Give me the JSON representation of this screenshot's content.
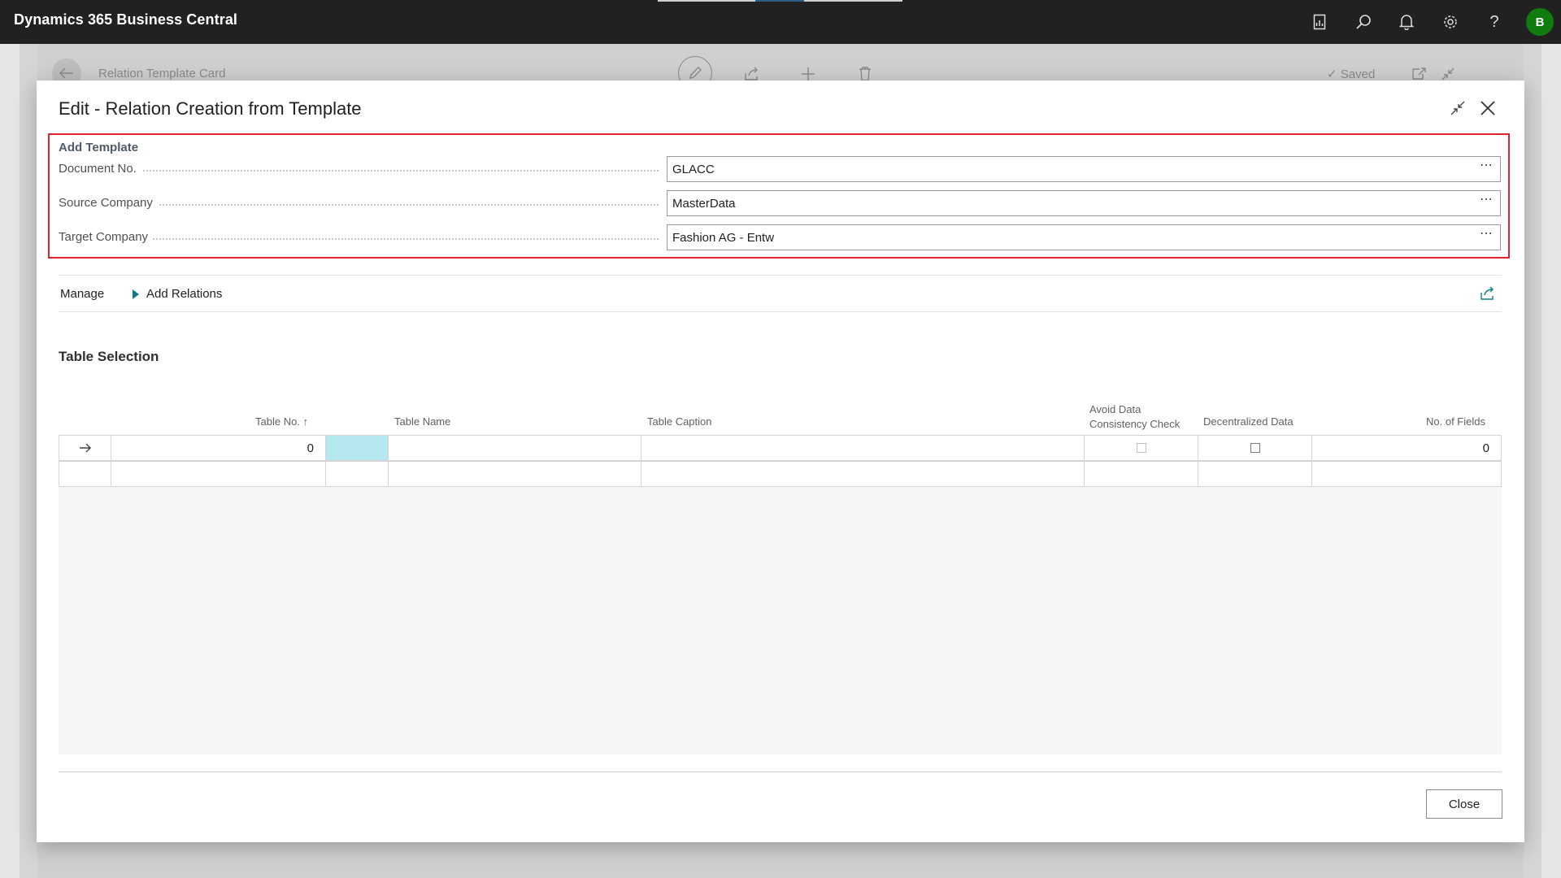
{
  "app": {
    "title": "Dynamics 365 Business Central",
    "avatar_initial": "B"
  },
  "topbar_icons": [
    "report-icon",
    "search-icon",
    "bell-icon",
    "gear-icon",
    "help-icon"
  ],
  "background_page": {
    "title": "Relation Template Card",
    "saved_label": "Saved"
  },
  "dialog": {
    "title": "Edit - Relation Creation from Template",
    "fasttab": {
      "title": "Add Template",
      "fields": [
        {
          "label": "Document No.",
          "value": "GLACC"
        },
        {
          "label": "Source Company",
          "value": "MasterData"
        },
        {
          "label": "Target Company",
          "value": "Fashion AG - Entw"
        }
      ],
      "ellipsis": "⋯"
    },
    "actions": {
      "manage": "Manage",
      "add_relations": "Add Relations"
    },
    "table_section": {
      "title": "Table Selection",
      "columns": {
        "table_no": "Table No. ↑",
        "table_name": "Table Name",
        "table_caption": "Table Caption",
        "avoid_check_1": "Avoid Data",
        "avoid_check_2": "Consistency Check",
        "decentralized": "Decentralized Data",
        "no_of_fields": "No. of Fields"
      },
      "rows": [
        {
          "table_no": "0",
          "table_name": "",
          "table_caption": "",
          "avoid_check": false,
          "decentralized": false,
          "no_of_fields": "0"
        }
      ]
    },
    "close_label": "Close"
  },
  "colors": {
    "highlight": "#e0222c",
    "selected_cell": "#b5e7ee",
    "avatar": "#107c10",
    "accent": "#0f7b8a"
  }
}
